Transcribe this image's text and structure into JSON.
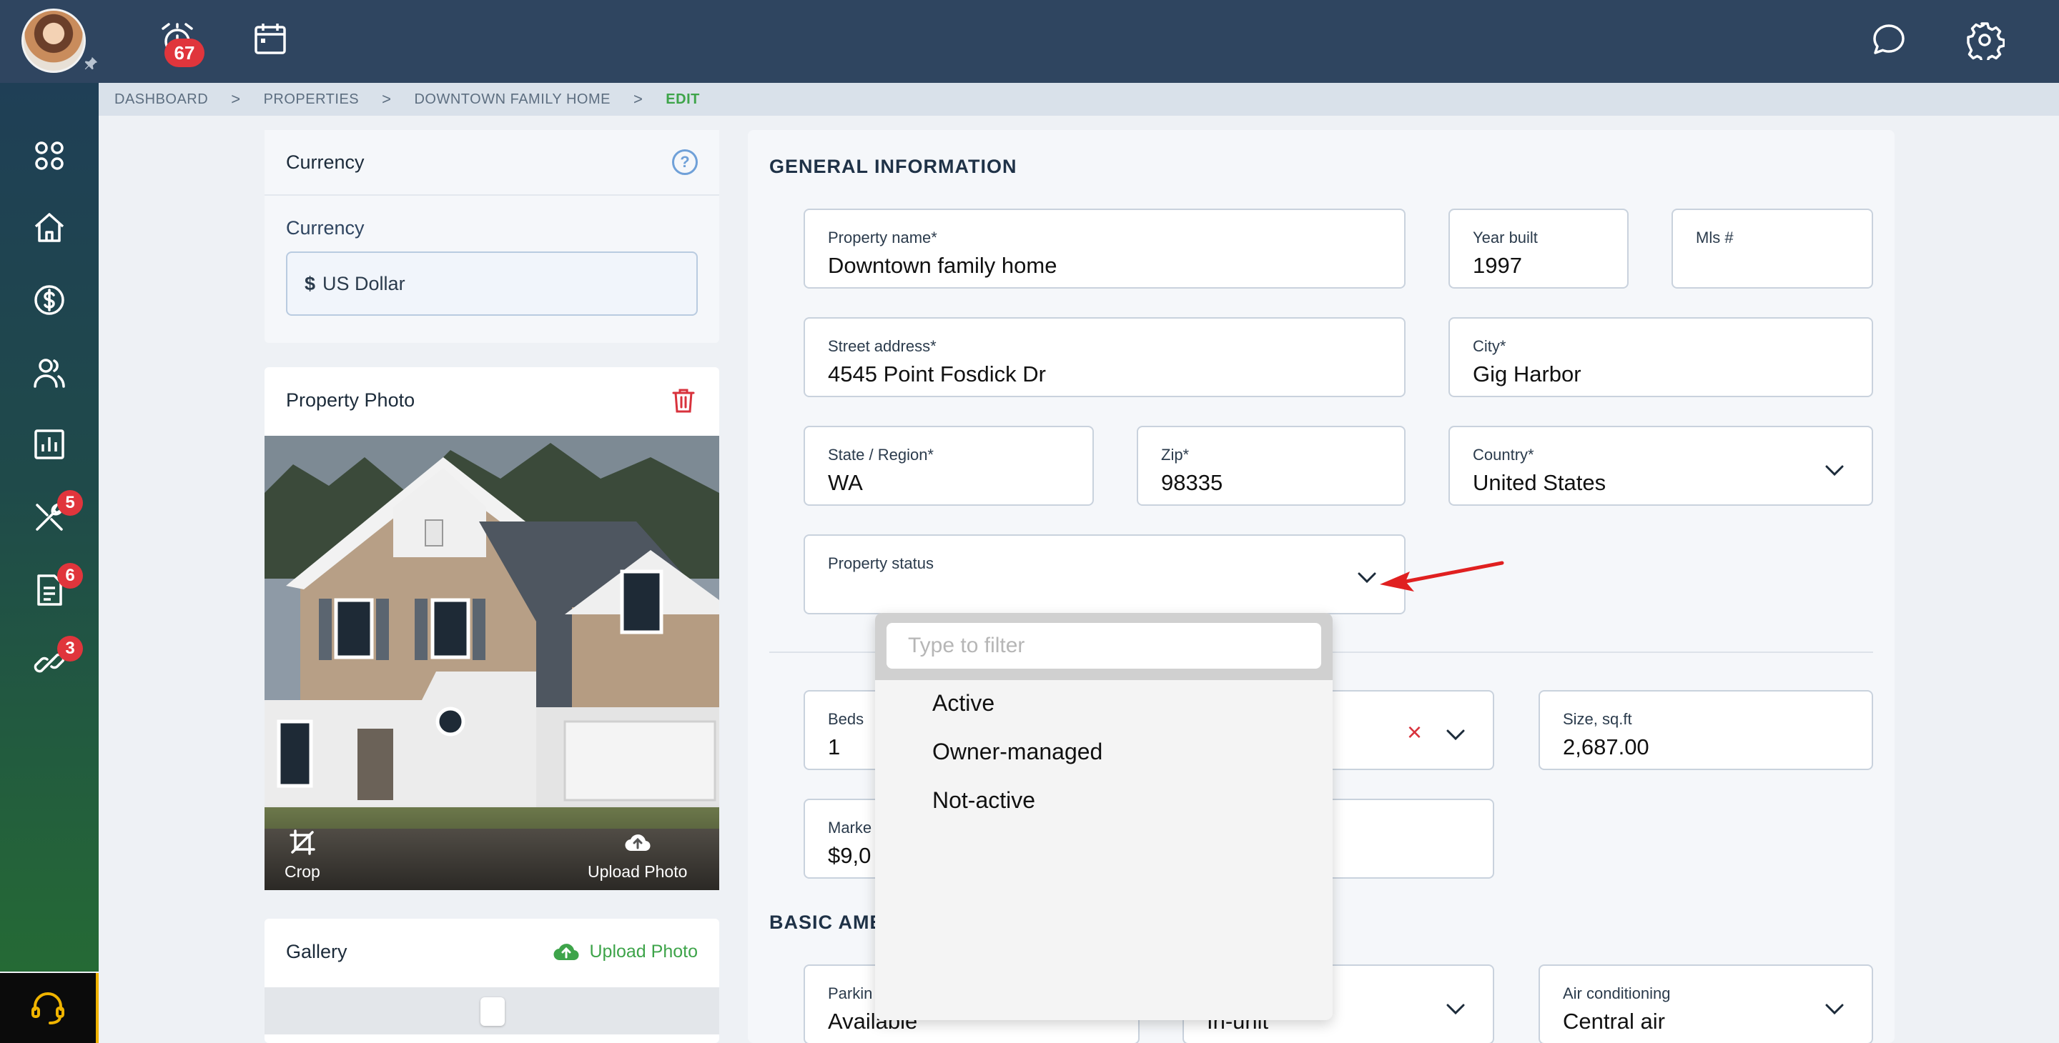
{
  "topbar": {
    "notification_count": "67",
    "icons": [
      "alarm-icon",
      "calendar-icon",
      "chat-icon",
      "gear-icon"
    ]
  },
  "sidebar": {
    "items": [
      {
        "name": "apps",
        "icon": "apps-icon",
        "badge": ""
      },
      {
        "name": "home",
        "icon": "home-icon",
        "badge": ""
      },
      {
        "name": "finance",
        "icon": "dollar-icon",
        "badge": ""
      },
      {
        "name": "people",
        "icon": "people-icon",
        "badge": ""
      },
      {
        "name": "reports",
        "icon": "chart-icon",
        "badge": ""
      },
      {
        "name": "maintenance",
        "icon": "tools-icon",
        "badge": "5"
      },
      {
        "name": "documents",
        "icon": "document-icon",
        "badge": "6"
      },
      {
        "name": "links",
        "icon": "link-icon",
        "badge": "3"
      }
    ]
  },
  "breadcrumb": {
    "dashboard": "DASHBOARD",
    "properties": "PROPERTIES",
    "property": "DOWNTOWN FAMILY HOME",
    "current": "EDIT",
    "sep": ">"
  },
  "currency_card": {
    "title": "Currency",
    "label": "Currency",
    "symbol": "$",
    "value": "US Dollar",
    "help": "?"
  },
  "photo_card": {
    "title": "Property Photo",
    "crop_label": "Crop",
    "upload_label": "Upload Photo"
  },
  "gallery_card": {
    "title": "Gallery",
    "upload_label": "Upload Photo"
  },
  "general": {
    "title": "GENERAL INFORMATION",
    "property_name": {
      "label": "Property name*",
      "value": "Downtown family home"
    },
    "year_built": {
      "label": "Year built",
      "value": "1997"
    },
    "mls": {
      "label": "Mls #",
      "value": ""
    },
    "street": {
      "label": "Street address*",
      "value": "4545 Point Fosdick Dr"
    },
    "city": {
      "label": "City*",
      "value": "Gig Harbor"
    },
    "state": {
      "label": "State / Region*",
      "value": "WA"
    },
    "zip": {
      "label": "Zip*",
      "value": "98335"
    },
    "country": {
      "label": "Country*",
      "value": "United States"
    },
    "status": {
      "label": "Property status",
      "value": ""
    }
  },
  "details": {
    "beds": {
      "label": "Beds",
      "value": "1"
    },
    "size": {
      "label": "Size, sq.ft",
      "value": "2,687.00"
    },
    "market": {
      "label": "Marke",
      "value": "$9,0"
    }
  },
  "amenities": {
    "title": "BASIC AME",
    "parking": {
      "label": "Parkin",
      "value": "Available"
    },
    "laundry": {
      "value": "In-unit"
    },
    "ac": {
      "label": "Air conditioning",
      "value": "Central air"
    }
  },
  "dropdown": {
    "placeholder": "Type to filter",
    "options": [
      "Active",
      "Owner-managed",
      "Not-active"
    ]
  },
  "colors": {
    "topbar": "#2f4560",
    "accent_green": "#3ea44a",
    "badge_red": "#e0353c",
    "arrow_red": "#e02020"
  }
}
